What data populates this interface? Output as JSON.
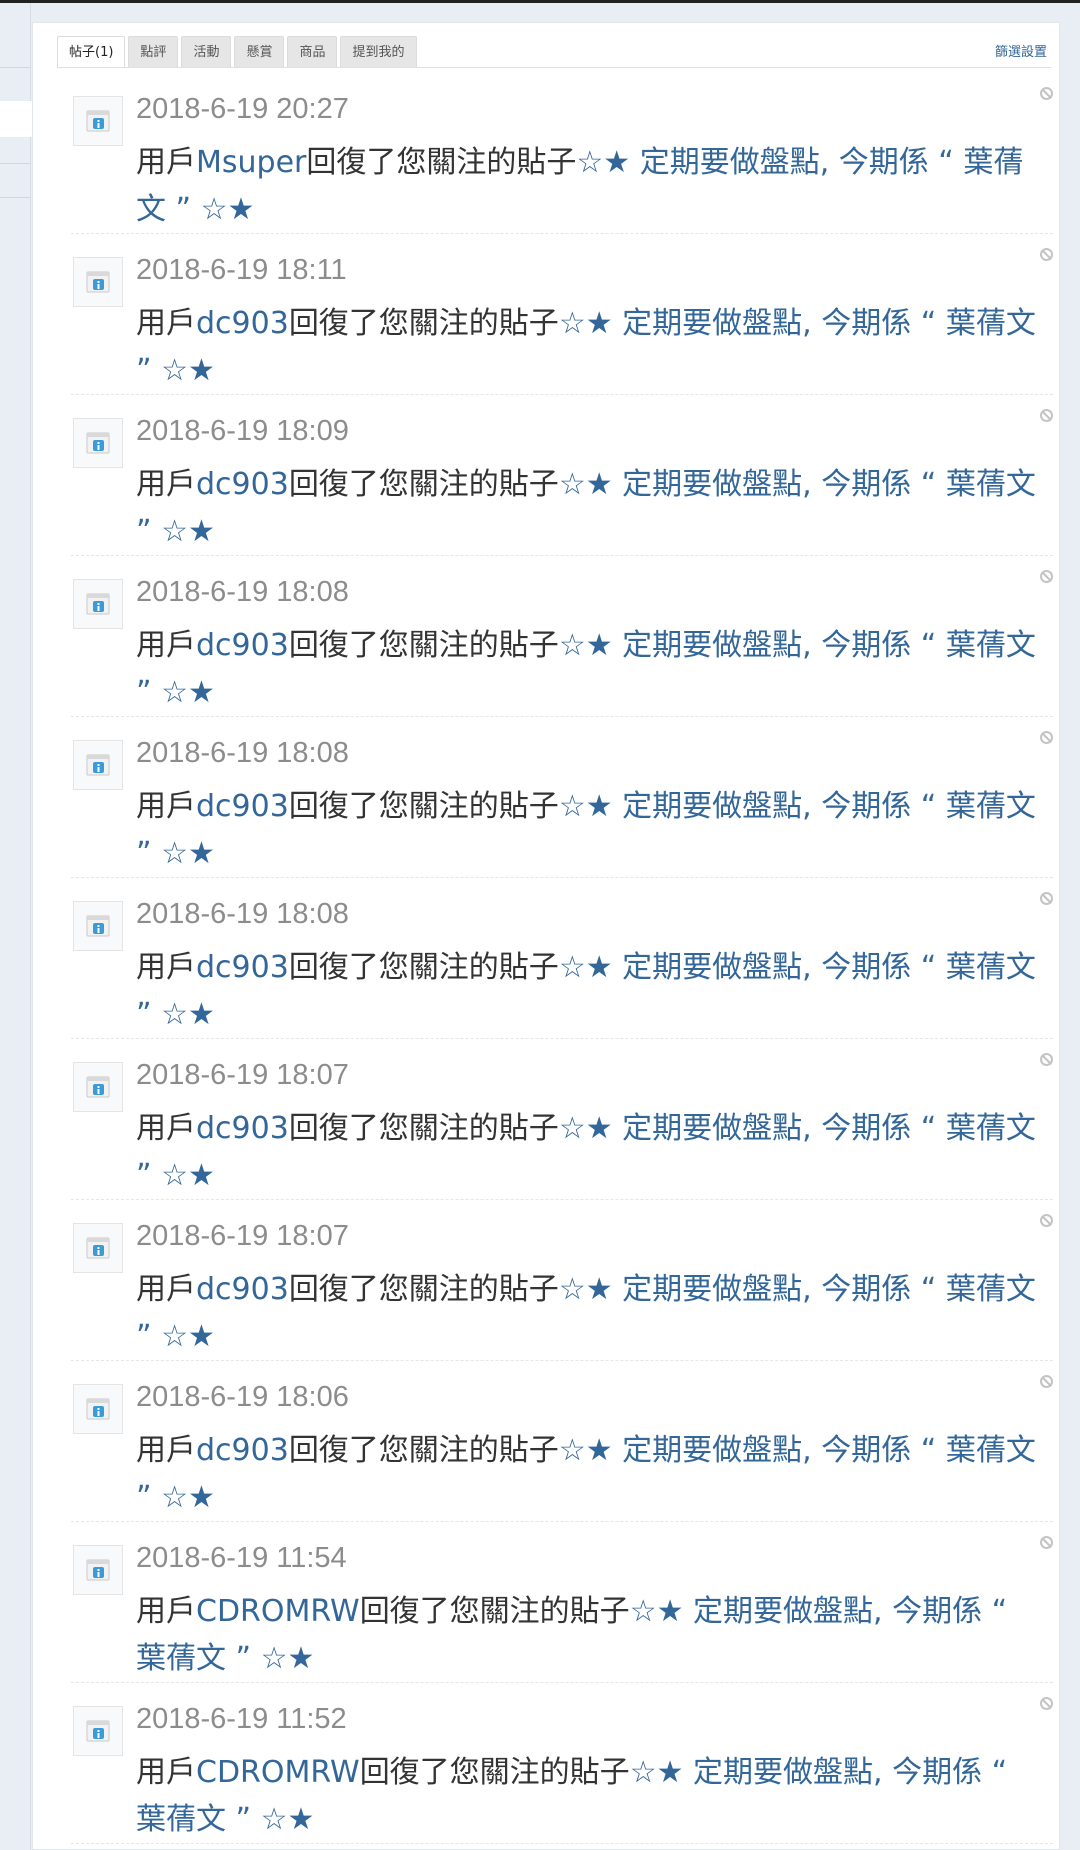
{
  "tabs": [
    {
      "label": "帖子(1)",
      "active": true
    },
    {
      "label": "點評",
      "active": false
    },
    {
      "label": "活動",
      "active": false
    },
    {
      "label": "懸賞",
      "active": false
    },
    {
      "label": "商品",
      "active": false
    },
    {
      "label": "提到我的",
      "active": false
    }
  ],
  "filter_label": "篩選設置",
  "notification_template": {
    "prefix": "用戶",
    "middle": "回復了您關注的貼子",
    "subject": "☆★ 定期要做盤點, 今期係 “ 葉蒨文 ” ☆★"
  },
  "notifications": [
    {
      "time": "2018-6-19 20:27",
      "user": "Msuper"
    },
    {
      "time": "2018-6-19 18:11",
      "user": "dc903"
    },
    {
      "time": "2018-6-19 18:09",
      "user": "dc903"
    },
    {
      "time": "2018-6-19 18:08",
      "user": "dc903"
    },
    {
      "time": "2018-6-19 18:08",
      "user": "dc903"
    },
    {
      "time": "2018-6-19 18:08",
      "user": "dc903"
    },
    {
      "time": "2018-6-19 18:07",
      "user": "dc903"
    },
    {
      "time": "2018-6-19 18:07",
      "user": "dc903"
    },
    {
      "time": "2018-6-19 18:06",
      "user": "dc903"
    },
    {
      "time": "2018-6-19 11:54",
      "user": "CDROMRW"
    },
    {
      "time": "2018-6-19 11:52",
      "user": "CDROMRW"
    }
  ]
}
